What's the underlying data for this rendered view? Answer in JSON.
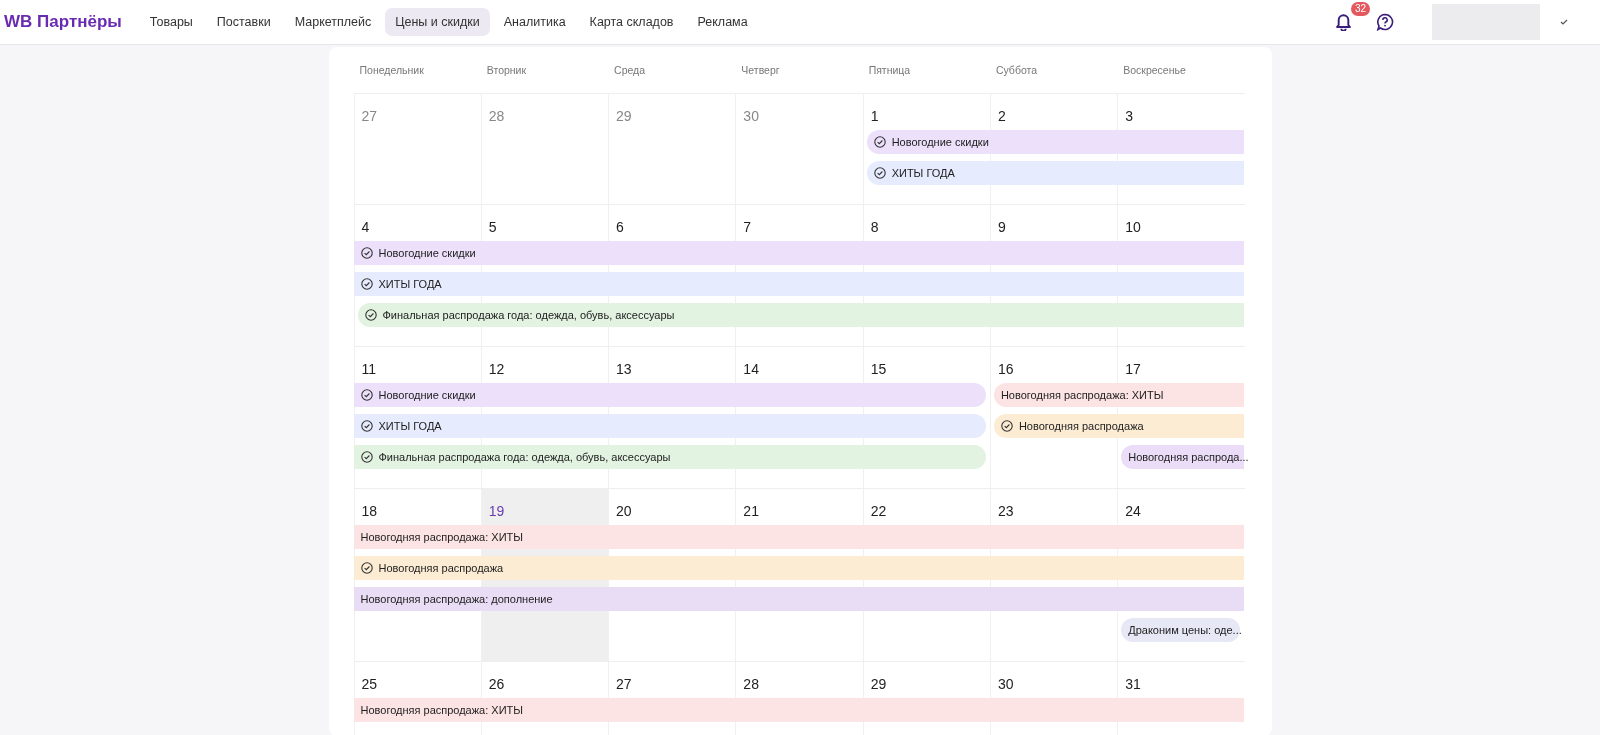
{
  "header": {
    "logo": "WB Партнёры",
    "nav": [
      {
        "label": "Товары",
        "selected": false
      },
      {
        "label": "Поставки",
        "selected": false
      },
      {
        "label": "Маркетплейс",
        "selected": false
      },
      {
        "label": "Цены и скидки",
        "selected": true
      },
      {
        "label": "Аналитика",
        "selected": false
      },
      {
        "label": "Карта складов",
        "selected": false
      },
      {
        "label": "Реклама",
        "selected": false
      }
    ],
    "notifications_badge": "32"
  },
  "calendar": {
    "weekdays": [
      "Понедельник",
      "Вторник",
      "Среда",
      "Четверг",
      "Пятница",
      "Суббота",
      "Воскресенье"
    ],
    "weeks": [
      {
        "days": [
          {
            "date": "27",
            "muted": true,
            "today": false
          },
          {
            "date": "28",
            "muted": true,
            "today": false
          },
          {
            "date": "29",
            "muted": true,
            "today": false
          },
          {
            "date": "30",
            "muted": true,
            "today": false
          },
          {
            "date": "1",
            "muted": false,
            "today": false
          },
          {
            "date": "2",
            "muted": false,
            "today": false
          },
          {
            "date": "3",
            "muted": false,
            "today": false
          }
        ],
        "lanes": [
          [
            {
              "kind": "empty"
            },
            {
              "kind": "empty"
            },
            {
              "kind": "empty"
            },
            {
              "kind": "empty"
            },
            {
              "kind": "event",
              "label": "Новогодние скидки",
              "color": "#ece0fb",
              "check": true,
              "continues_before": false,
              "continues_after": true
            },
            {
              "kind": "continued"
            },
            {
              "kind": "continued"
            }
          ],
          [
            {
              "kind": "empty"
            },
            {
              "kind": "empty"
            },
            {
              "kind": "empty"
            },
            {
              "kind": "empty"
            },
            {
              "kind": "event",
              "label": "ХИТЫ ГОДА",
              "color": "#e6ebfd",
              "check": true,
              "continues_before": false,
              "continues_after": true
            },
            {
              "kind": "continued"
            },
            {
              "kind": "continued"
            }
          ]
        ]
      },
      {
        "days": [
          {
            "date": "4",
            "muted": false,
            "today": false
          },
          {
            "date": "5",
            "muted": false,
            "today": false
          },
          {
            "date": "6",
            "muted": false,
            "today": false
          },
          {
            "date": "7",
            "muted": false,
            "today": false
          },
          {
            "date": "8",
            "muted": false,
            "today": false
          },
          {
            "date": "9",
            "muted": false,
            "today": false
          },
          {
            "date": "10",
            "muted": false,
            "today": false
          }
        ],
        "lanes": [
          [
            {
              "kind": "event",
              "label": "Новогодние скидки",
              "color": "#ece0fb",
              "check": true,
              "continues_before": true,
              "continues_after": true
            },
            {
              "kind": "continued"
            },
            {
              "kind": "continued"
            },
            {
              "kind": "continued"
            },
            {
              "kind": "continued"
            },
            {
              "kind": "continued"
            },
            {
              "kind": "continued"
            }
          ],
          [
            {
              "kind": "event",
              "label": "ХИТЫ ГОДА",
              "color": "#e6ebfd",
              "check": true,
              "continues_before": true,
              "continues_after": true
            },
            {
              "kind": "continued"
            },
            {
              "kind": "continued"
            },
            {
              "kind": "continued"
            },
            {
              "kind": "continued"
            },
            {
              "kind": "continued"
            },
            {
              "kind": "continued"
            }
          ],
          [
            {
              "kind": "event",
              "label": "Финальная распродажа года: одежда, обувь, аксессуары",
              "color": "#e3f3e1",
              "check": true,
              "continues_before": false,
              "continues_after": true
            },
            {
              "kind": "continued"
            },
            {
              "kind": "continued"
            },
            {
              "kind": "continued"
            },
            {
              "kind": "continued"
            },
            {
              "kind": "continued"
            },
            {
              "kind": "continued"
            }
          ]
        ]
      },
      {
        "days": [
          {
            "date": "11",
            "muted": false,
            "today": false
          },
          {
            "date": "12",
            "muted": false,
            "today": false
          },
          {
            "date": "13",
            "muted": false,
            "today": false
          },
          {
            "date": "14",
            "muted": false,
            "today": false
          },
          {
            "date": "15",
            "muted": false,
            "today": false
          },
          {
            "date": "16",
            "muted": false,
            "today": false
          },
          {
            "date": "17",
            "muted": false,
            "today": false
          }
        ],
        "lanes": [
          [
            {
              "kind": "event",
              "label": "Новогодние скидки",
              "color": "#ece0fb",
              "check": true,
              "continues_before": true,
              "continues_after": false
            },
            {
              "kind": "continued"
            },
            {
              "kind": "continued"
            },
            {
              "kind": "continued"
            },
            {
              "kind": "continued"
            },
            {
              "kind": "event",
              "label": "Новогодняя распродажа: ХИТЫ",
              "color": "#fde4e4",
              "check": false,
              "continues_before": false,
              "continues_after": true
            },
            {
              "kind": "continued"
            }
          ],
          [
            {
              "kind": "event",
              "label": "ХИТЫ ГОДА",
              "color": "#e6ebfd",
              "check": true,
              "continues_before": true,
              "continues_after": false
            },
            {
              "kind": "continued"
            },
            {
              "kind": "continued"
            },
            {
              "kind": "continued"
            },
            {
              "kind": "continued"
            },
            {
              "kind": "event",
              "label": "Новогодняя распродажа",
              "color": "#fdecd4",
              "check": true,
              "continues_before": false,
              "continues_after": true
            },
            {
              "kind": "continued"
            }
          ],
          [
            {
              "kind": "event",
              "label": "Финальная распродажа года: одежда, обувь, аксессуары",
              "color": "#e3f3e1",
              "check": true,
              "continues_before": true,
              "continues_after": false
            },
            {
              "kind": "continued"
            },
            {
              "kind": "continued"
            },
            {
              "kind": "continued"
            },
            {
              "kind": "continued"
            },
            {
              "kind": "empty"
            },
            {
              "kind": "event",
              "label": "Новогодняя распрода...",
              "color": "#ebdcf7",
              "check": false,
              "continues_before": false,
              "continues_after": true
            }
          ]
        ]
      },
      {
        "days": [
          {
            "date": "18",
            "muted": false,
            "today": false
          },
          {
            "date": "19",
            "muted": false,
            "today": true
          },
          {
            "date": "20",
            "muted": false,
            "today": false
          },
          {
            "date": "21",
            "muted": false,
            "today": false
          },
          {
            "date": "22",
            "muted": false,
            "today": false
          },
          {
            "date": "23",
            "muted": false,
            "today": false
          },
          {
            "date": "24",
            "muted": false,
            "today": false
          }
        ],
        "lanes": [
          [
            {
              "kind": "event",
              "label": "Новогодняя распродажа: ХИТЫ",
              "color": "#fde4e4",
              "check": false,
              "continues_before": true,
              "continues_after": true
            },
            {
              "kind": "continued"
            },
            {
              "kind": "continued"
            },
            {
              "kind": "continued"
            },
            {
              "kind": "continued"
            },
            {
              "kind": "continued"
            },
            {
              "kind": "continued"
            }
          ],
          [
            {
              "kind": "event",
              "label": "Новогодняя распродажа",
              "color": "#fdecd4",
              "check": true,
              "continues_before": true,
              "continues_after": true
            },
            {
              "kind": "continued"
            },
            {
              "kind": "continued"
            },
            {
              "kind": "continued"
            },
            {
              "kind": "continued"
            },
            {
              "kind": "continued"
            },
            {
              "kind": "continued"
            }
          ],
          [
            {
              "kind": "event",
              "label": "Новогодняя распродажа: дополнение",
              "color": "#e9dcf5",
              "check": false,
              "continues_before": true,
              "continues_after": true
            },
            {
              "kind": "continued"
            },
            {
              "kind": "continued"
            },
            {
              "kind": "continued"
            },
            {
              "kind": "continued"
            },
            {
              "kind": "continued"
            },
            {
              "kind": "continued"
            }
          ],
          [
            {
              "kind": "empty"
            },
            {
              "kind": "empty"
            },
            {
              "kind": "empty"
            },
            {
              "kind": "empty"
            },
            {
              "kind": "empty"
            },
            {
              "kind": "empty"
            },
            {
              "kind": "event",
              "label": "Драконим цены: оде...",
              "color": "#e6e8f5",
              "check": false,
              "continues_before": false,
              "continues_after": false
            }
          ]
        ]
      },
      {
        "days": [
          {
            "date": "25",
            "muted": false,
            "today": false
          },
          {
            "date": "26",
            "muted": false,
            "today": false
          },
          {
            "date": "27",
            "muted": false,
            "today": false
          },
          {
            "date": "28",
            "muted": false,
            "today": false
          },
          {
            "date": "29",
            "muted": false,
            "today": false
          },
          {
            "date": "30",
            "muted": false,
            "today": false
          },
          {
            "date": "31",
            "muted": false,
            "today": false
          }
        ],
        "lanes": [
          [
            {
              "kind": "event",
              "label": "Новогодняя распродажа: ХИТЫ",
              "color": "#fde4e4",
              "check": false,
              "continues_before": true,
              "continues_after": true
            },
            {
              "kind": "continued"
            },
            {
              "kind": "continued"
            },
            {
              "kind": "continued"
            },
            {
              "kind": "continued"
            },
            {
              "kind": "continued"
            },
            {
              "kind": "continued"
            }
          ]
        ]
      }
    ]
  }
}
